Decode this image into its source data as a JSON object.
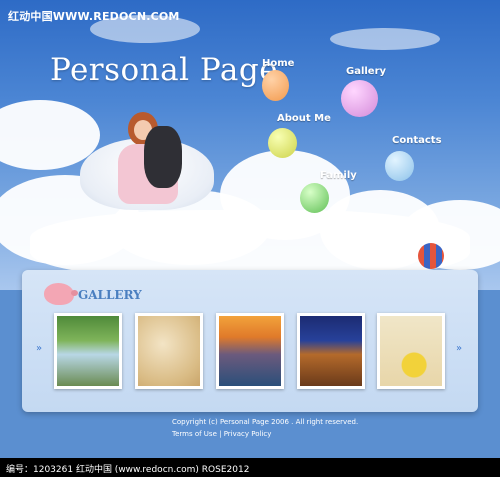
{
  "watermark": "红动中国WWW.REDOCN.COM",
  "header": {
    "title": "Personal Page"
  },
  "nav": {
    "home": "Home",
    "gallery": "Gallery",
    "about": "About Me",
    "contacts": "Contacts",
    "family": "Family"
  },
  "gallery": {
    "title": "GALLERY",
    "prev_icon": "»",
    "next_icon": "»",
    "thumbnails": [
      {
        "label": "waterfall photo"
      },
      {
        "label": "pasta photo"
      },
      {
        "label": "sunset lake photo"
      },
      {
        "label": "castle photo"
      },
      {
        "label": "kayak photo"
      }
    ]
  },
  "footer": {
    "copyright": "Copyright (c) Personal Page 2006 . All right reserved.",
    "links": "Terms of Use | Privacy Policy"
  },
  "bottom_bar": {
    "text": "编号：1203261    红动中国 (www.redocn.com)    ROSE2012"
  },
  "colors": {
    "sky_top": "#2e6bc6",
    "panel_bg": "#d6e5f7",
    "accent_blue": "#3f7ad0"
  }
}
